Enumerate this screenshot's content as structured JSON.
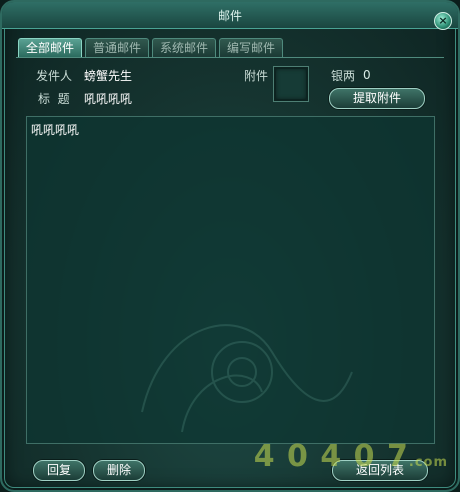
{
  "window": {
    "title": "邮件",
    "close_glyph": "×"
  },
  "tabs": [
    {
      "label": "全部邮件",
      "active": true
    },
    {
      "label": "普通邮件",
      "active": false
    },
    {
      "label": "系统邮件",
      "active": false
    },
    {
      "label": "编写邮件",
      "active": false
    }
  ],
  "mail": {
    "sender_label": "发件人",
    "sender_value": "螃蟹先生",
    "subject_label": "标  题",
    "subject_value": "吼吼吼吼",
    "attachment_label": "附件",
    "silver_label": "银两",
    "silver_value": "0",
    "extract_button": "提取附件",
    "body": "吼吼吼吼"
  },
  "buttons": {
    "reply": "回复",
    "delete": "删除",
    "back": "返回列表"
  },
  "watermark": {
    "text": "4 0 4 0 7",
    "suffix": ".com"
  },
  "colors": {
    "accent": "#4aa394",
    "panel": "#15332f"
  }
}
